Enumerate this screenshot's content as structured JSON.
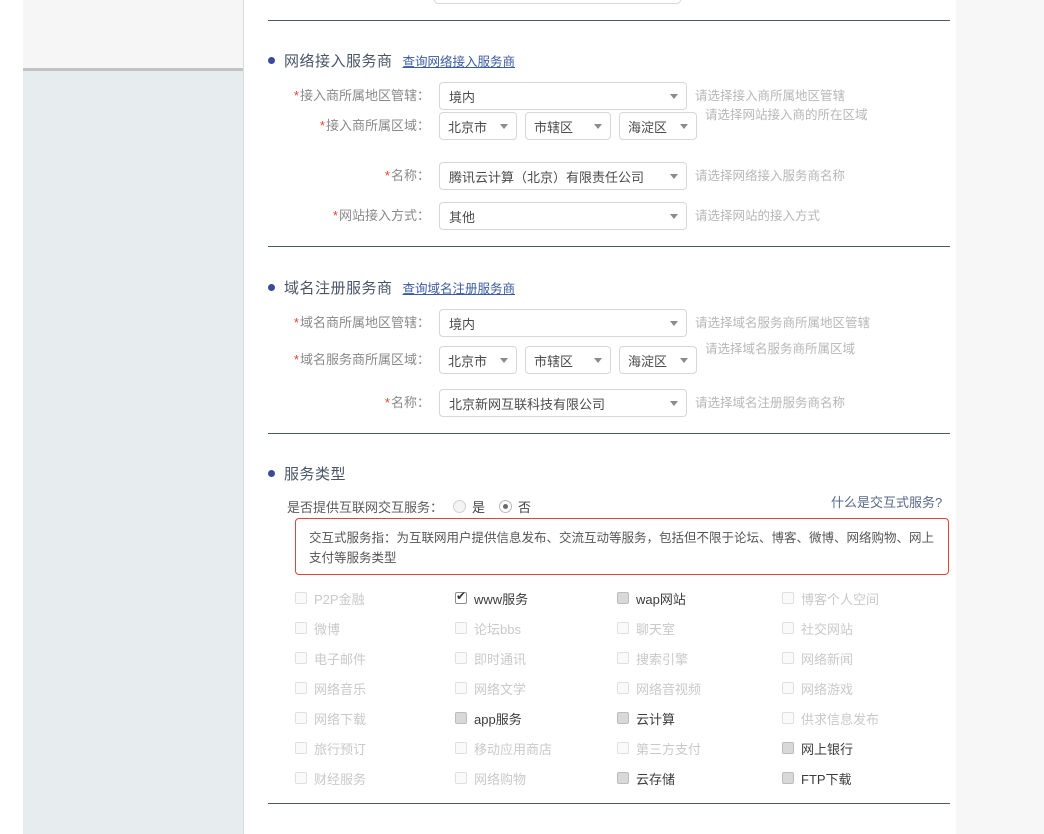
{
  "sections": {
    "isp": {
      "title": "网络接入服务商",
      "link": "查询网络接入服务商",
      "fields": [
        {
          "label": "接入商所属地区管辖",
          "required": true,
          "value": "境内",
          "hint": "请选择接入商所属地区管辖"
        },
        {
          "label": "接入商所属区域",
          "required": true,
          "values": [
            "北京市",
            "市辖区",
            "海淀区"
          ],
          "hint": "请选择网站接入商的所在区域"
        },
        {
          "label": "名称",
          "required": true,
          "value": "腾讯云计算（北京）有限责任公司",
          "hint": "请选择网络接入服务商名称"
        },
        {
          "label": "网站接入方式",
          "required": true,
          "value": "其他",
          "hint": "请选择网站的接入方式"
        }
      ]
    },
    "registrar": {
      "title": "域名注册服务商",
      "link": "查询域名注册服务商",
      "fields": [
        {
          "label": "域名商所属地区管辖",
          "required": true,
          "value": "境内",
          "hint": "请选择域名服务商所属地区管辖"
        },
        {
          "label": "域名服务商所属区域",
          "required": true,
          "values": [
            "北京市",
            "市辖区",
            "海淀区"
          ],
          "hint": "请选择域名服务商所属区域"
        },
        {
          "label": "名称",
          "required": true,
          "value": "北京新网互联科技有限公司",
          "hint": "请选择域名注册服务商名称"
        }
      ]
    },
    "service_type": {
      "title": "服务类型",
      "interactive_question": "是否提供互联网交互服务：",
      "radio_yes": "是",
      "radio_no": "否",
      "radio_selected": "否",
      "help_link": "什么是交互式服务?",
      "notice": "交互式服务指：为互联网用户提供信息发布、交流互动等服务，包括但不限于论坛、博客、微博、网络购物、网上支付等服务类型",
      "checkbox_rows": [
        [
          {
            "label": "P2P金融",
            "state": "disabled"
          },
          {
            "label": "www服务",
            "state": "checked"
          },
          {
            "label": "wap网站",
            "state": "enabled"
          },
          {
            "label": "博客个人空间",
            "state": "disabled"
          }
        ],
        [
          {
            "label": "微博",
            "state": "disabled"
          },
          {
            "label": "论坛bbs",
            "state": "disabled"
          },
          {
            "label": "聊天室",
            "state": "disabled"
          },
          {
            "label": "社交网站",
            "state": "disabled"
          }
        ],
        [
          {
            "label": "电子邮件",
            "state": "disabled"
          },
          {
            "label": "即时通讯",
            "state": "disabled"
          },
          {
            "label": "搜索引擎",
            "state": "disabled"
          },
          {
            "label": "网络新闻",
            "state": "disabled"
          }
        ],
        [
          {
            "label": "网络音乐",
            "state": "disabled"
          },
          {
            "label": "网络文学",
            "state": "disabled"
          },
          {
            "label": "网络音视频",
            "state": "disabled"
          },
          {
            "label": "网络游戏",
            "state": "disabled"
          }
        ],
        [
          {
            "label": "网络下载",
            "state": "disabled"
          },
          {
            "label": "app服务",
            "state": "enabled"
          },
          {
            "label": "云计算",
            "state": "enabled"
          },
          {
            "label": "供求信息发布",
            "state": "disabled"
          }
        ],
        [
          {
            "label": "旅行预订",
            "state": "disabled"
          },
          {
            "label": "移动应用商店",
            "state": "disabled"
          },
          {
            "label": "第三方支付",
            "state": "disabled"
          },
          {
            "label": "网上银行",
            "state": "enabled"
          }
        ],
        [
          {
            "label": "财经服务",
            "state": "disabled"
          },
          {
            "label": "网络购物",
            "state": "disabled"
          },
          {
            "label": "云存储",
            "state": "enabled"
          },
          {
            "label": "FTP下载",
            "state": "enabled"
          }
        ]
      ]
    }
  },
  "colors": {
    "accent_blue": "#3b4a99",
    "link_blue": "#3a5ba0",
    "required_red": "#e8432d",
    "notice_border": "#e0443a",
    "label_gray": "#8a8a8a",
    "hint_gray": "#b7b7b7"
  }
}
